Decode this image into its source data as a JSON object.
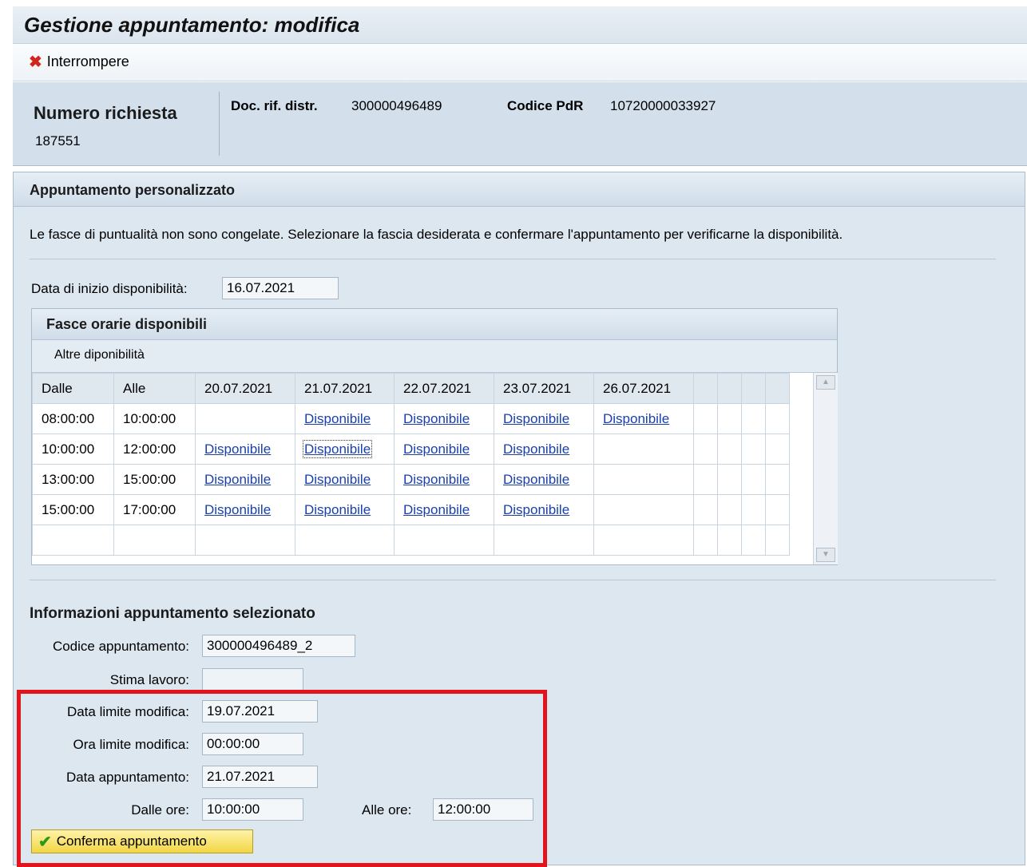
{
  "title": "Gestione appuntamento: modifica",
  "toolbar": {
    "cancel_label": "Interrompere"
  },
  "header": {
    "request_label": "Numero richiesta",
    "request_value": "187551",
    "doc_label": "Doc. rif. distr.",
    "doc_value": "300000496489",
    "pdr_label": "Codice PdR",
    "pdr_value": "10720000033927"
  },
  "section": {
    "title": "Appuntamento personalizzato",
    "info": "Le fasce di puntualità non sono congelate. Selezionare la fascia desiderata e confermare l'appuntamento per verificarne la disponibilità.",
    "start_date_label": "Data di inizio disponibilità:",
    "start_date_value": "16.07.2021"
  },
  "slots": {
    "title": "Fasce orarie disponibili",
    "subtitle": "Altre diponibilità",
    "columns": [
      "Dalle",
      "Alle",
      "20.07.2021",
      "21.07.2021",
      "22.07.2021",
      "23.07.2021",
      "26.07.2021"
    ],
    "rows": [
      [
        "08:00:00",
        "10:00:00",
        "",
        "Disponibile",
        "Disponibile",
        "Disponibile",
        "Disponibile"
      ],
      [
        "10:00:00",
        "12:00:00",
        "Disponibile",
        "Disponibile",
        "Disponibile",
        "Disponibile",
        ""
      ],
      [
        "13:00:00",
        "15:00:00",
        "Disponibile",
        "Disponibile",
        "Disponibile",
        "Disponibile",
        ""
      ],
      [
        "15:00:00",
        "17:00:00",
        "Disponibile",
        "Disponibile",
        "Disponibile",
        "Disponibile",
        ""
      ]
    ]
  },
  "selected": {
    "title": "Informazioni appuntamento selezionato",
    "code_label": "Codice appuntamento:",
    "code_value": "300000496489_2",
    "estimate_label": "Stima lavoro:",
    "estimate_value": "",
    "limit_date_label": "Data limite modifica:",
    "limit_date_value": "19.07.2021",
    "limit_time_label": "Ora limite modifica:",
    "limit_time_value": "00:00:00",
    "appt_date_label": "Data appuntamento:",
    "appt_date_value": "21.07.2021",
    "from_label": "Dalle ore:",
    "from_value": "10:00:00",
    "to_label": "Alle ore:",
    "to_value": "12:00:00",
    "confirm_label": "Conferma appuntamento"
  },
  "colors": {
    "highlight": "#e3141b",
    "link": "#1a3faa",
    "panel": "#dde7f0"
  }
}
